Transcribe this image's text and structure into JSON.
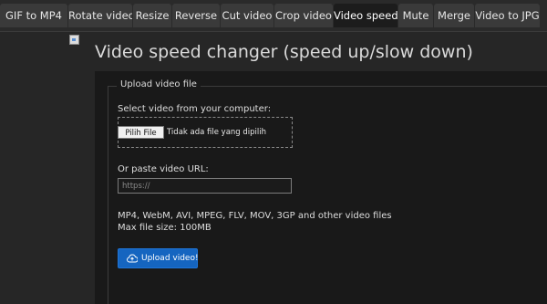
{
  "nav": {
    "tabs": [
      {
        "label": "GIF to MP4"
      },
      {
        "label": "Rotate video"
      },
      {
        "label": "Resize"
      },
      {
        "label": "Reverse"
      },
      {
        "label": "Cut video"
      },
      {
        "label": "Crop video"
      },
      {
        "label": "Video speed",
        "active": true
      },
      {
        "label": "Mute"
      },
      {
        "label": "Merge"
      },
      {
        "label": "Video to JPG"
      }
    ]
  },
  "page": {
    "title": "Video speed changer (speed up/slow down)"
  },
  "upload": {
    "legend": "Upload video file",
    "select_label": "Select video from your computer:",
    "file_button": "Pilih File",
    "file_status": "Tidak ada file yang dipilih",
    "url_label": "Or paste video URL:",
    "url_placeholder": "https://",
    "url_value": "",
    "formats": "MP4, WebM, AVI, MPEG, FLV, MOV, 3GP and other video files",
    "max_size": "Max file size: 100MB",
    "submit_label": "Upload video!"
  },
  "colors": {
    "background": "#262626",
    "card": "#191919",
    "tab": "#3a3a3a",
    "active_tab": "#1c1c1c",
    "accent": "#1565c0"
  },
  "icons": {
    "broken_image": "broken-image-icon",
    "upload": "cloud-upload-icon"
  }
}
